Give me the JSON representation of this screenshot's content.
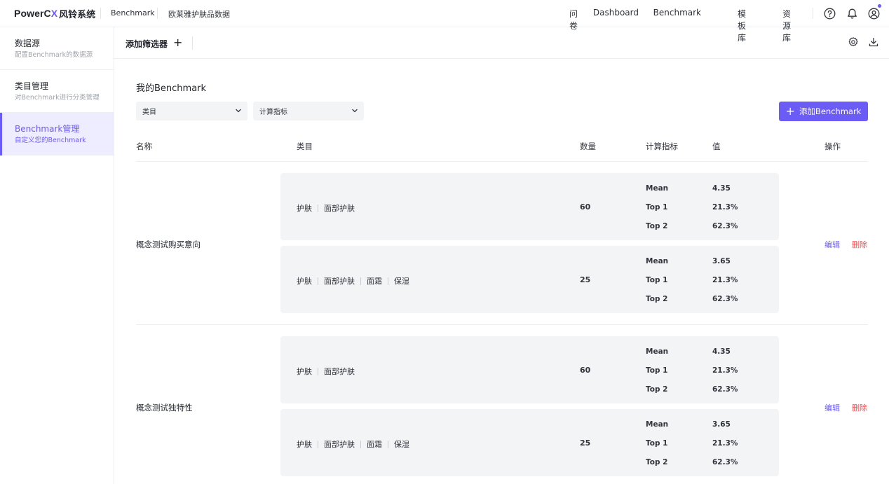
{
  "header": {
    "brand": {
      "name": "PowerC",
      "x": "X",
      "cn": "风铃系统"
    },
    "breadcrumb": [
      "Benchmark",
      "欧莱雅护肤品数据"
    ],
    "nav": [
      "问卷",
      "Dashboard",
      "Benchmark",
      "模板库",
      "资源库"
    ],
    "icons": [
      "help-icon",
      "bell-icon",
      "user-icon"
    ]
  },
  "sidebar": {
    "items": [
      {
        "title": "数据源",
        "sub": "配置Benchmark的数据源"
      },
      {
        "title": "类目管理",
        "sub": "对Benchmark进行分类管理"
      },
      {
        "title": "Benchmark管理",
        "sub": "自定义您的Benchmark",
        "active": true
      }
    ]
  },
  "filterbar": {
    "label": "添加筛选器",
    "plus": "+"
  },
  "main": {
    "title": "我的Benchmark",
    "selects": [
      {
        "value": "类目"
      },
      {
        "value": "计算指标"
      }
    ],
    "add_button": "添加Benchmark",
    "columns": {
      "name": "名称",
      "category": "类目",
      "count": "数量",
      "metric": "计算指标",
      "value": "值",
      "action": "操作"
    },
    "groups": [
      {
        "name": "概念测试购买意向",
        "edit": "编辑",
        "delete": "删除",
        "rows": [
          {
            "categories": [
              "护肤",
              "面部护肤"
            ],
            "count": "60",
            "metrics": [
              {
                "name": "Mean",
                "value": "4.35"
              },
              {
                "name": "Top 1",
                "value": "21.3%"
              },
              {
                "name": "Top 2",
                "value": "62.3%"
              }
            ]
          },
          {
            "categories": [
              "护肤",
              "面部护肤",
              "面霜",
              "保湿"
            ],
            "count": "25",
            "metrics": [
              {
                "name": "Mean",
                "value": "3.65"
              },
              {
                "name": "Top 1",
                "value": "21.3%"
              },
              {
                "name": "Top 2",
                "value": "62.3%"
              }
            ]
          }
        ]
      },
      {
        "name": "概念测试独特性",
        "edit": "编辑",
        "delete": "删除",
        "rows": [
          {
            "categories": [
              "护肤",
              "面部护肤"
            ],
            "count": "60",
            "metrics": [
              {
                "name": "Mean",
                "value": "4.35"
              },
              {
                "name": "Top 1",
                "value": "21.3%"
              },
              {
                "name": "Top 2",
                "value": "62.3%"
              }
            ]
          },
          {
            "categories": [
              "护肤",
              "面部护肤",
              "面霜",
              "保湿"
            ],
            "count": "25",
            "metrics": [
              {
                "name": "Mean",
                "value": "3.65"
              },
              {
                "name": "Top 1",
                "value": "21.3%"
              },
              {
                "name": "Top 2",
                "value": "62.3%"
              }
            ]
          }
        ]
      }
    ]
  },
  "colors": {
    "accent": "#6b5cf6",
    "danger": "#f5474a",
    "card": "#f3f4f6",
    "border": "#eceef2"
  }
}
